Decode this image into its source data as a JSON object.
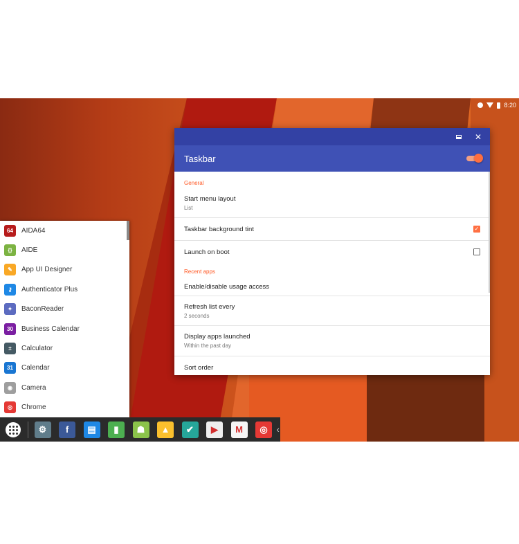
{
  "status_bar": {
    "time": "8:20"
  },
  "window": {
    "title": "Taskbar",
    "toggle_on": true,
    "accent_color": "#3f51b5",
    "sections": [
      {
        "header": "General",
        "items": [
          {
            "title": "Start menu layout",
            "subtitle": "List"
          },
          {
            "title": "Taskbar background tint",
            "checkbox": true
          },
          {
            "title": "Launch on boot",
            "checkbox": false
          }
        ]
      },
      {
        "header": "Recent apps",
        "items": [
          {
            "title": "Enable/disable usage access"
          },
          {
            "title": "Refresh list every",
            "subtitle": "2 seconds"
          },
          {
            "title": "Display apps launched",
            "subtitle": "Within the past day"
          },
          {
            "title": "Sort order"
          }
        ]
      }
    ]
  },
  "start_menu": {
    "apps": [
      {
        "label": "AIDA64",
        "icon": "aida64-icon",
        "color": "#b71c1c",
        "glyph": "64"
      },
      {
        "label": "AIDE",
        "icon": "aide-icon",
        "color": "#7cb342",
        "glyph": "{}"
      },
      {
        "label": "App UI Designer",
        "icon": "app-ui-designer-icon",
        "color": "#f9a825",
        "glyph": "✎"
      },
      {
        "label": "Authenticator Plus",
        "icon": "authenticator-plus-icon",
        "color": "#1e88e5",
        "glyph": "⚷"
      },
      {
        "label": "BaconReader",
        "icon": "baconreader-icon",
        "color": "#5c6bc0",
        "glyph": "✦"
      },
      {
        "label": "Business Calendar",
        "icon": "business-calendar-icon",
        "color": "#7b1fa2",
        "glyph": "30"
      },
      {
        "label": "Calculator",
        "icon": "calculator-icon",
        "color": "#455a64",
        "glyph": "±"
      },
      {
        "label": "Calendar",
        "icon": "calendar-icon",
        "color": "#1976d2",
        "glyph": "31"
      },
      {
        "label": "Camera",
        "icon": "camera-icon",
        "color": "#9e9e9e",
        "glyph": "◉"
      },
      {
        "label": "Chrome",
        "icon": "chrome-icon",
        "color": "#e53935",
        "glyph": "◎"
      }
    ]
  },
  "taskbar": {
    "pinned": [
      {
        "icon": "settings-gear-icon",
        "color": "#607d8b",
        "glyph": "⚙"
      },
      {
        "icon": "facebook-icon",
        "color": "#3b5998",
        "glyph": "f"
      },
      {
        "icon": "files-icon",
        "color": "#1e88e5",
        "glyph": "▤"
      },
      {
        "icon": "pushbullet-icon",
        "color": "#4caf50",
        "glyph": "▮"
      },
      {
        "icon": "android-icon",
        "color": "#8bc34a",
        "glyph": "☗"
      },
      {
        "icon": "google-drive-icon",
        "color": "#fbc02d",
        "glyph": "▲"
      },
      {
        "icon": "checkmark-app-icon",
        "color": "#26a69a",
        "glyph": "✔"
      },
      {
        "icon": "play-store-icon",
        "color": "#eeeeee",
        "glyph": "▶"
      },
      {
        "icon": "gmail-icon",
        "color": "#f5f5f5",
        "glyph": "M"
      },
      {
        "icon": "chrome-icon",
        "color": "#e53935",
        "glyph": "◎"
      }
    ]
  }
}
